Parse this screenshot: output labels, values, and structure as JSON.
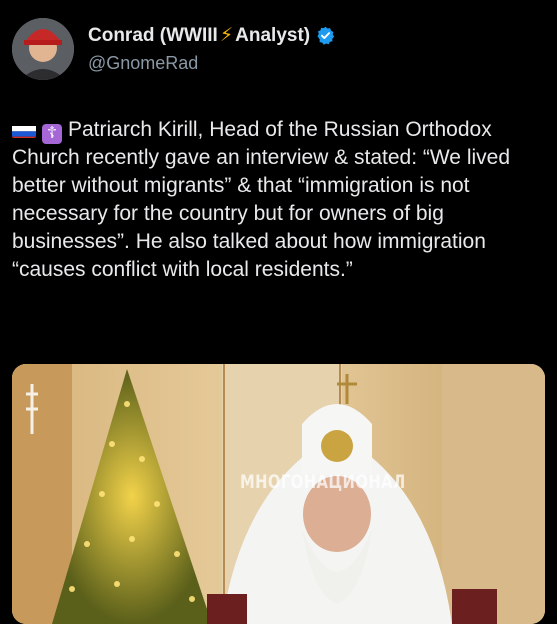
{
  "author": {
    "name_prefix": "Conrad (WWIII",
    "name_bolt": "⚡",
    "name_suffix": " Analyst)",
    "handle": "@GnomeRad",
    "verified": true,
    "avatar_icon": "user-avatar"
  },
  "post": {
    "emoji_flag": "russia-flag",
    "emoji_cross": "☦",
    "text": "Patriarch Kirill, Head of the Russian Orthodox Church recently gave an interview & stated: “We lived better without migrants” & that “immigration is not necessary for the country but for owners of big businesses”. He also talked about how immigration “causes conflict with local residents.”"
  },
  "media": {
    "caption": "МНОГОНАЦИОНАЛ"
  },
  "colors": {
    "background": "#000000",
    "text": "#e7e9ea",
    "handle": "#8b98a5",
    "verified": "#1d9bf0",
    "bolt": "#f4b400"
  }
}
